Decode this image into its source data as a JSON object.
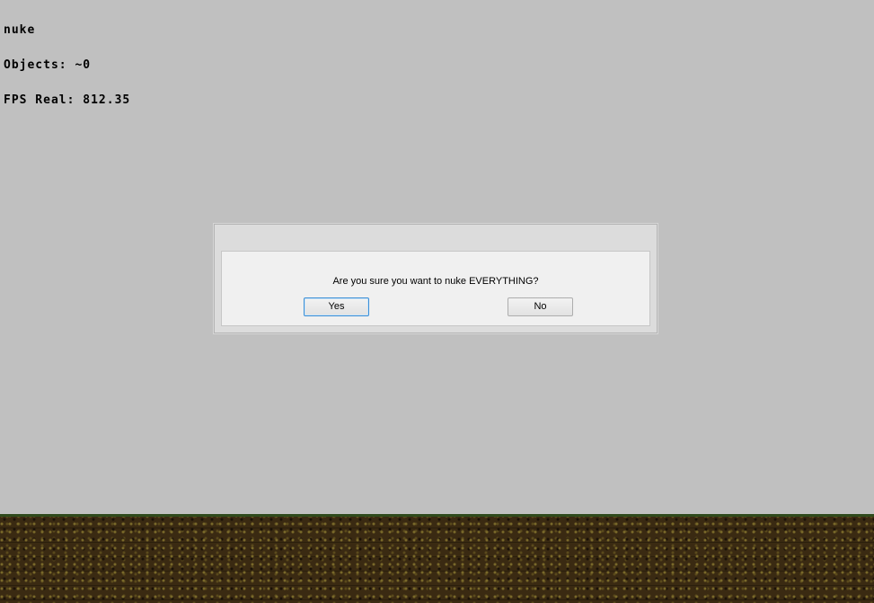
{
  "hud": {
    "line1": "nuke",
    "line2": "Objects: ~0",
    "line3": "FPS Real: 812.35"
  },
  "dialog": {
    "message": "Are you sure you want to nuke EVERYTHING?",
    "yes_label": "Yes",
    "no_label": "No",
    "default_button": "Yes"
  },
  "colors": {
    "background": "#c0c0c0",
    "dialog_frame": "#dcdcdc",
    "dialog_body": "#f0f0f0",
    "default_button_border": "#3c8fd6",
    "ground": "#3a2a12",
    "ground_edge": "#2f4a1c"
  }
}
